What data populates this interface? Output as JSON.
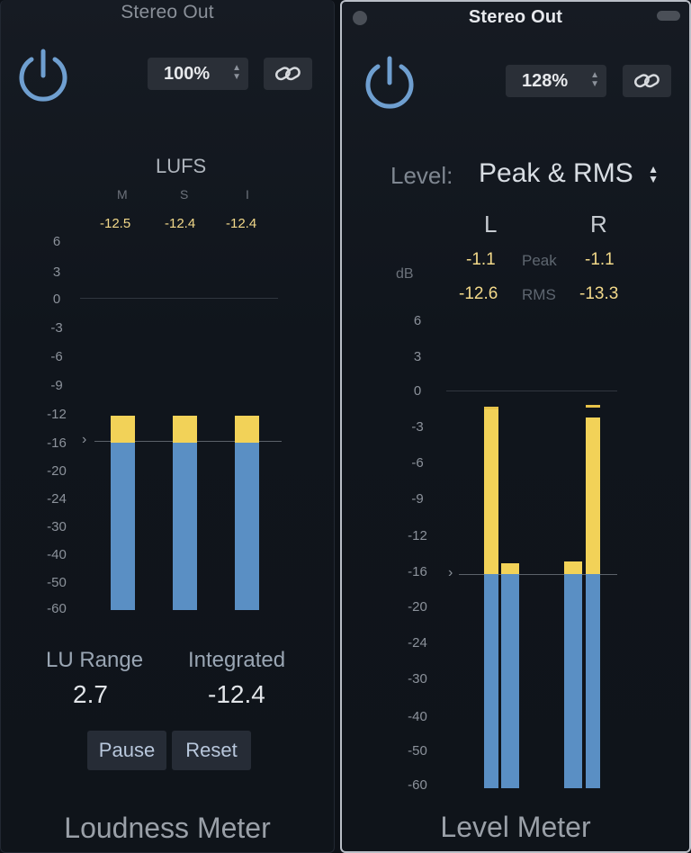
{
  "loudness": {
    "title": "Stereo Out",
    "zoom": "100%",
    "lufs_label": "LUFS",
    "columns": [
      "M",
      "S",
      "I"
    ],
    "values": [
      "-12.5",
      "-12.4",
      "-12.4"
    ],
    "scale": [
      "6",
      "3",
      "0",
      "-3",
      "-6",
      "-9",
      "-12",
      "-16",
      "-20",
      "-24",
      "-30",
      "-40",
      "-50",
      "-60"
    ],
    "lu_range_label": "LU Range",
    "lu_range_value": "2.7",
    "integrated_label": "Integrated",
    "integrated_value": "-12.4",
    "pause_label": "Pause",
    "reset_label": "Reset",
    "footer": "Loudness Meter"
  },
  "level": {
    "title": "Stereo Out",
    "zoom": "128%",
    "mode_label": "Level:",
    "mode_value": "Peak & RMS",
    "left_channel": "L",
    "right_channel": "R",
    "peak_label": "Peak",
    "rms_label": "RMS",
    "db_label": "dB",
    "peak_left": "-1.1",
    "peak_right": "-1.1",
    "rms_left": "-12.6",
    "rms_right": "-13.3",
    "scale": [
      "6",
      "3",
      "0",
      "-3",
      "-6",
      "-9",
      "-12",
      "-16",
      "-20",
      "-24",
      "-30",
      "-40",
      "-50",
      "-60"
    ],
    "footer": "Level Meter"
  },
  "colors": {
    "meter_blue": "#5a8fc4",
    "meter_yellow": "#f2d258",
    "value_yellow": "#f3d98a",
    "power_ring": "#6f9fd0"
  }
}
